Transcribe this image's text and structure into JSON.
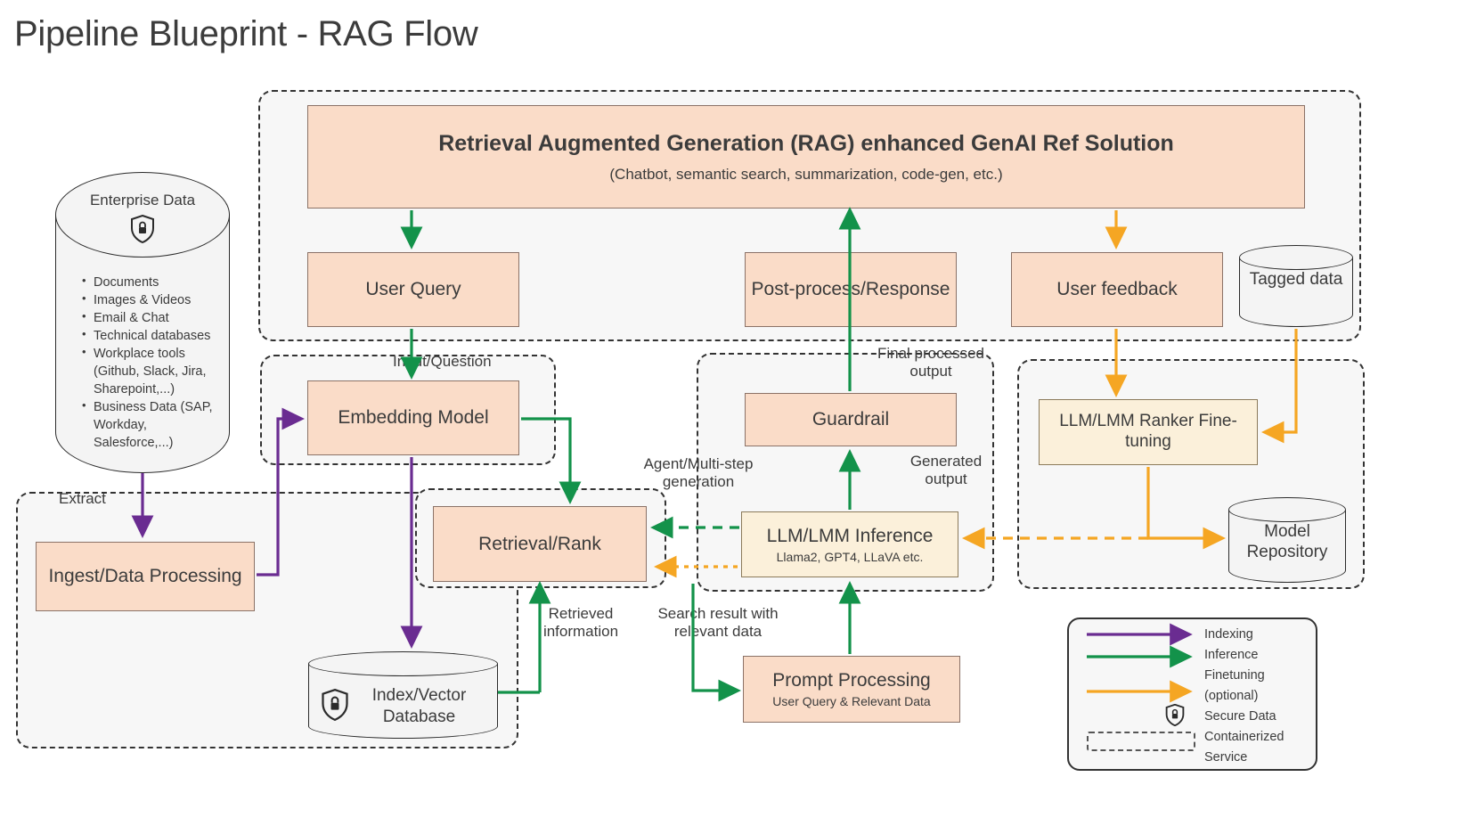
{
  "title": "Pipeline Blueprint - RAG Flow",
  "colors": {
    "indexing": "#6a2c91",
    "inference": "#13924a",
    "finetuning": "#f5a623",
    "box_fill": "#fadcc8",
    "box_fill_yellow": "#fbf0da",
    "zone_bg": "#f7f7f7"
  },
  "enterprise": {
    "title": "Enterprise Data",
    "icon": "secure-shield-lock-icon",
    "items": [
      "Documents",
      "Images & Videos",
      "Email & Chat",
      "Technical databases",
      "Workplace tools (Github, Slack, Jira, Sharepoint,...)",
      "Business Data (SAP, Workday, Salesforce,...)"
    ]
  },
  "boxes": {
    "rag_solution": {
      "title": "Retrieval Augmented Generation (RAG) enhanced GenAI Ref Solution",
      "subtitle": "(Chatbot, semantic search, summarization, code-gen, etc.)"
    },
    "user_query": "User Query",
    "post_process": "Post-process/Response",
    "user_feedback": "User feedback",
    "embedding_model": "Embedding Model",
    "guardrail": "Guardrail",
    "ranker_finetune": "LLM/LMM Ranker Fine-tuning",
    "retrieval_rank": "Retrieval/Rank",
    "llm_inference": {
      "title": "LLM/LMM Inference",
      "subtitle": "Llama2, GPT4, LLaVA etc."
    },
    "ingest": "Ingest/Data Processing",
    "prompt_processing": {
      "title": "Prompt Processing",
      "subtitle": "User Query & Relevant Data"
    }
  },
  "cylinders": {
    "tagged_data": "Tagged data",
    "model_repository": "Model Repository",
    "index_vector_db": "Index/Vector Database"
  },
  "edge_labels": {
    "input_question": "Input/Question",
    "extract": "Extract",
    "final_processed_output": "Final processed output",
    "generated_output": "Generated output",
    "agent_multistep": "Agent/Multi-step generation",
    "retrieved_information": "Retrieved information",
    "search_result": "Search result with relevant data"
  },
  "legend": {
    "items": [
      {
        "label": "Indexing",
        "sample": "arrow-purple"
      },
      {
        "label": "Inference",
        "sample": "arrow-green"
      },
      {
        "label": "Finetuning",
        "sample": "arrow-orange"
      },
      {
        "label": "(optional)",
        "sample": "none"
      },
      {
        "label": "Secure Data",
        "sample": "shield-lock-icon"
      },
      {
        "label": "Containerized",
        "sample": "none"
      },
      {
        "label": "Service",
        "sample": "dashed-box"
      }
    ]
  }
}
